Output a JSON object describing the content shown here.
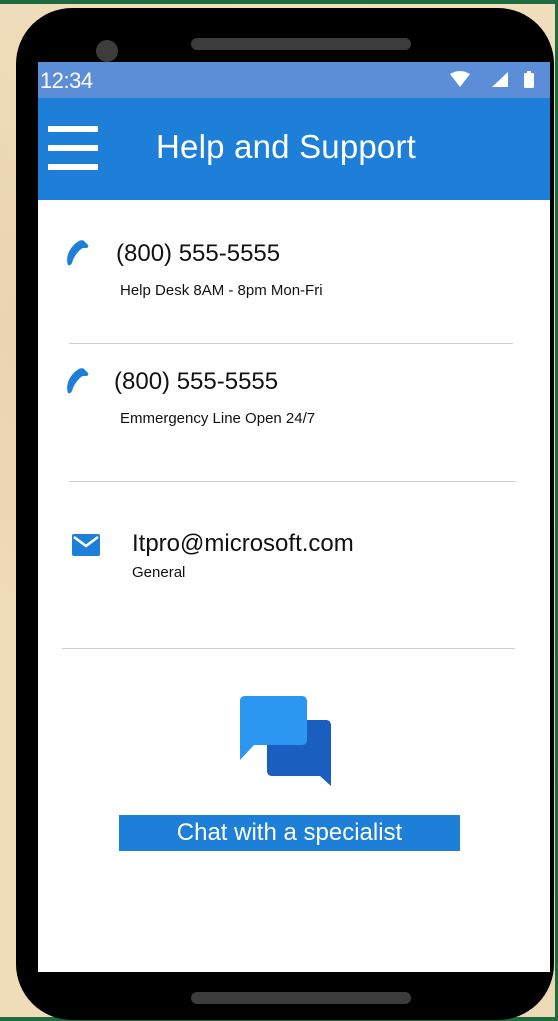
{
  "status_bar": {
    "time": "12:34"
  },
  "app_bar": {
    "title": "Help and Support",
    "menu_icon": "hamburger-menu-icon"
  },
  "contacts": [
    {
      "icon": "phone-icon",
      "primary": "(800) 555-5555",
      "secondary": "Help Desk 8AM - 8pm Mon-Fri"
    },
    {
      "icon": "phone-icon",
      "primary": "(800) 555-5555",
      "secondary": "Emmergency Line  Open 24/7"
    },
    {
      "icon": "mail-icon",
      "primary": "Itpro@microsoft.com",
      "secondary": "General"
    }
  ],
  "chat": {
    "icon": "chat-bubbles-icon",
    "button_label": "Chat with a specialist"
  },
  "colors": {
    "accent": "#1e7fd8",
    "status_bar": "#5b8ed6",
    "background": "#efdcb8",
    "frame": "#000000",
    "border": "#1e6b3d"
  }
}
